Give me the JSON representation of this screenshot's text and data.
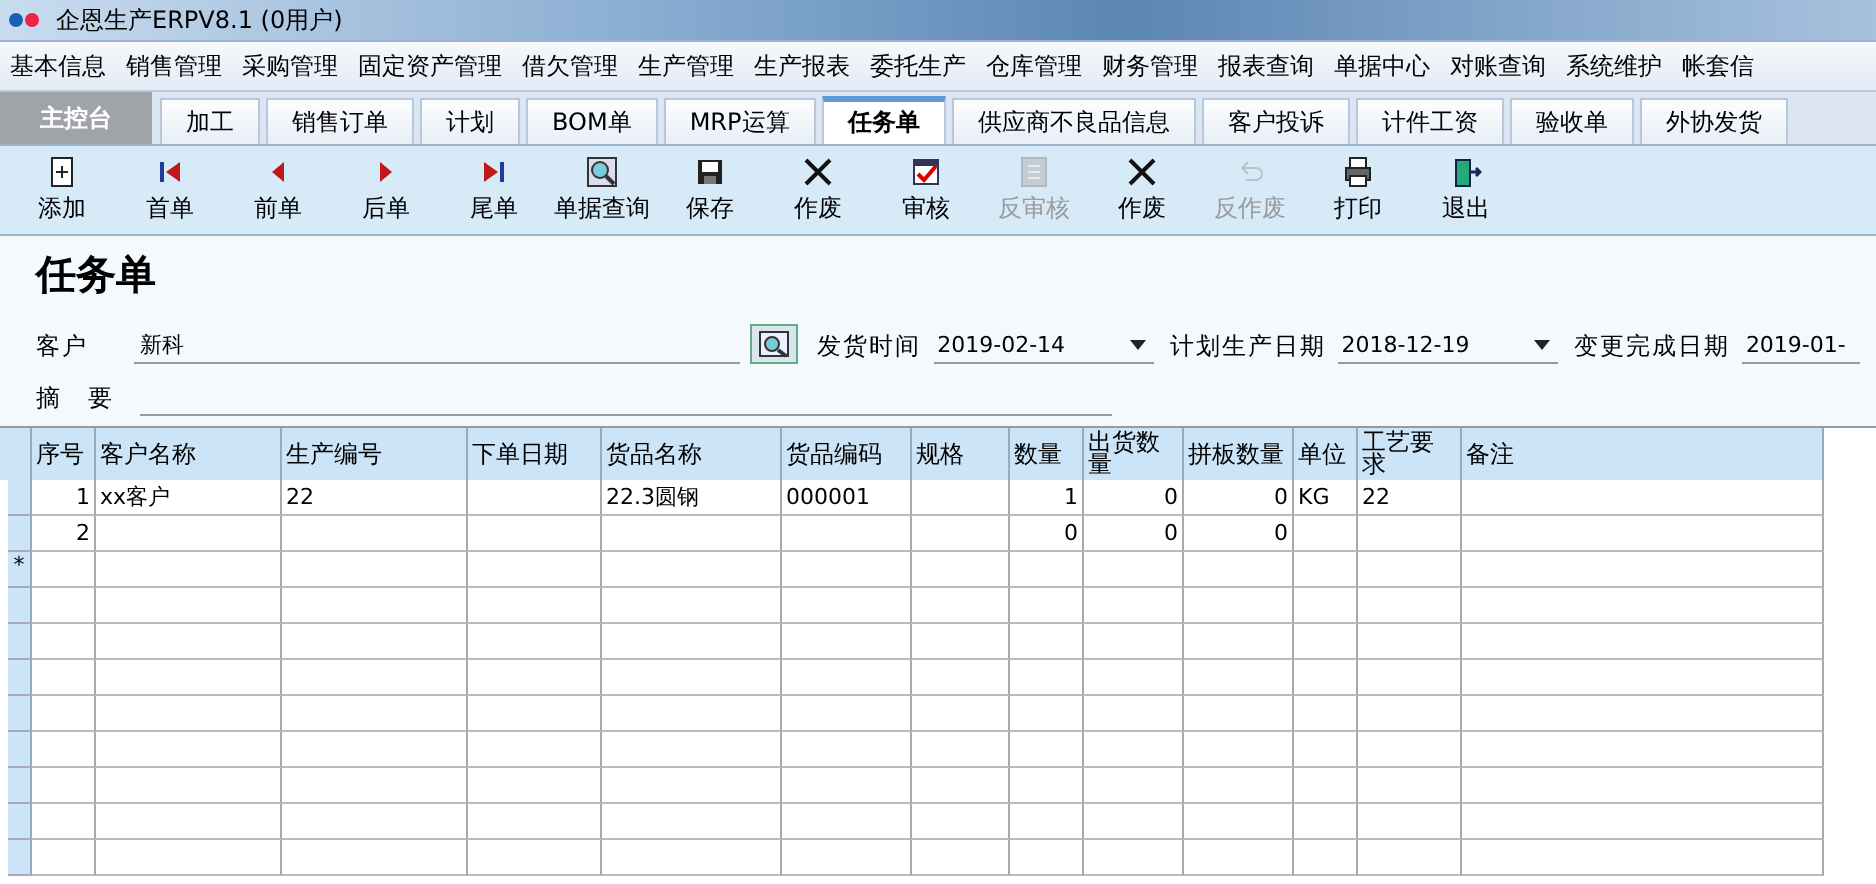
{
  "window": {
    "title": "企恩生产ERPV8.1 (0用户)"
  },
  "menu": [
    "基本信息",
    "销售管理",
    "采购管理",
    "固定资产管理",
    "借欠管理",
    "生产管理",
    "生产报表",
    "委托生产",
    "仓库管理",
    "财务管理",
    "报表查询",
    "单据中心",
    "对账查询",
    "系统维护",
    "帐套信"
  ],
  "tabs": [
    {
      "label": "主控台",
      "kind": "home",
      "selected": false
    },
    {
      "label": "加工",
      "kind": "tab",
      "selected": false
    },
    {
      "label": "销售订单",
      "kind": "tab",
      "selected": false
    },
    {
      "label": "计划",
      "kind": "tab",
      "selected": false
    },
    {
      "label": "BOM单",
      "kind": "tab",
      "selected": false
    },
    {
      "label": "MRP运算",
      "kind": "tab",
      "selected": false
    },
    {
      "label": "任务单",
      "kind": "tab",
      "selected": true
    },
    {
      "label": "供应商不良品信息",
      "kind": "tab",
      "selected": false
    },
    {
      "label": "客户投诉",
      "kind": "tab",
      "selected": false
    },
    {
      "label": "计件工资",
      "kind": "tab",
      "selected": false
    },
    {
      "label": "验收单",
      "kind": "tab",
      "selected": false
    },
    {
      "label": "外协发货",
      "kind": "tab",
      "selected": false
    }
  ],
  "toolbar": [
    {
      "label": "添加",
      "disabled": false
    },
    {
      "label": "首单",
      "disabled": false
    },
    {
      "label": "前单",
      "disabled": false
    },
    {
      "label": "后单",
      "disabled": false
    },
    {
      "label": "尾单",
      "disabled": false
    },
    {
      "label": "单据查询",
      "disabled": false
    },
    {
      "label": "保存",
      "disabled": false
    },
    {
      "label": "作废",
      "disabled": false
    },
    {
      "label": "审核",
      "disabled": false
    },
    {
      "label": "反审核",
      "disabled": true
    },
    {
      "label": "作废",
      "disabled": false
    },
    {
      "label": "反作废",
      "disabled": true
    },
    {
      "label": "打印",
      "disabled": false
    },
    {
      "label": "退出",
      "disabled": false
    }
  ],
  "form": {
    "title": "任务单",
    "customer": {
      "label": "客户",
      "value": "新科"
    },
    "ship_date": {
      "label": "发货时间",
      "value": "2019-02-14"
    },
    "plan_date": {
      "label": "计划生产日期",
      "value": "2018-12-19"
    },
    "change_date": {
      "label": "变更完成日期",
      "value": "2019-01-"
    },
    "summary": {
      "label": "摘　要"
    }
  },
  "table": {
    "columns": [
      "序号",
      "客户名称",
      "生产编号",
      "下单日期",
      "货品名称",
      "货品编码",
      "规格",
      "数量",
      "出货数量",
      "拼板数量",
      "单位",
      "工艺要求",
      "备注"
    ],
    "rows": [
      [
        "1",
        "xx客户",
        "22",
        "",
        "22.3圆钢",
        "000001",
        "",
        "1",
        "0",
        "0",
        "KG",
        "22",
        ""
      ],
      [
        "2",
        "",
        "",
        "",
        "",
        "",
        "",
        "0",
        "0",
        "0",
        "",
        "",
        ""
      ]
    ],
    "new_row_marker": "*"
  }
}
